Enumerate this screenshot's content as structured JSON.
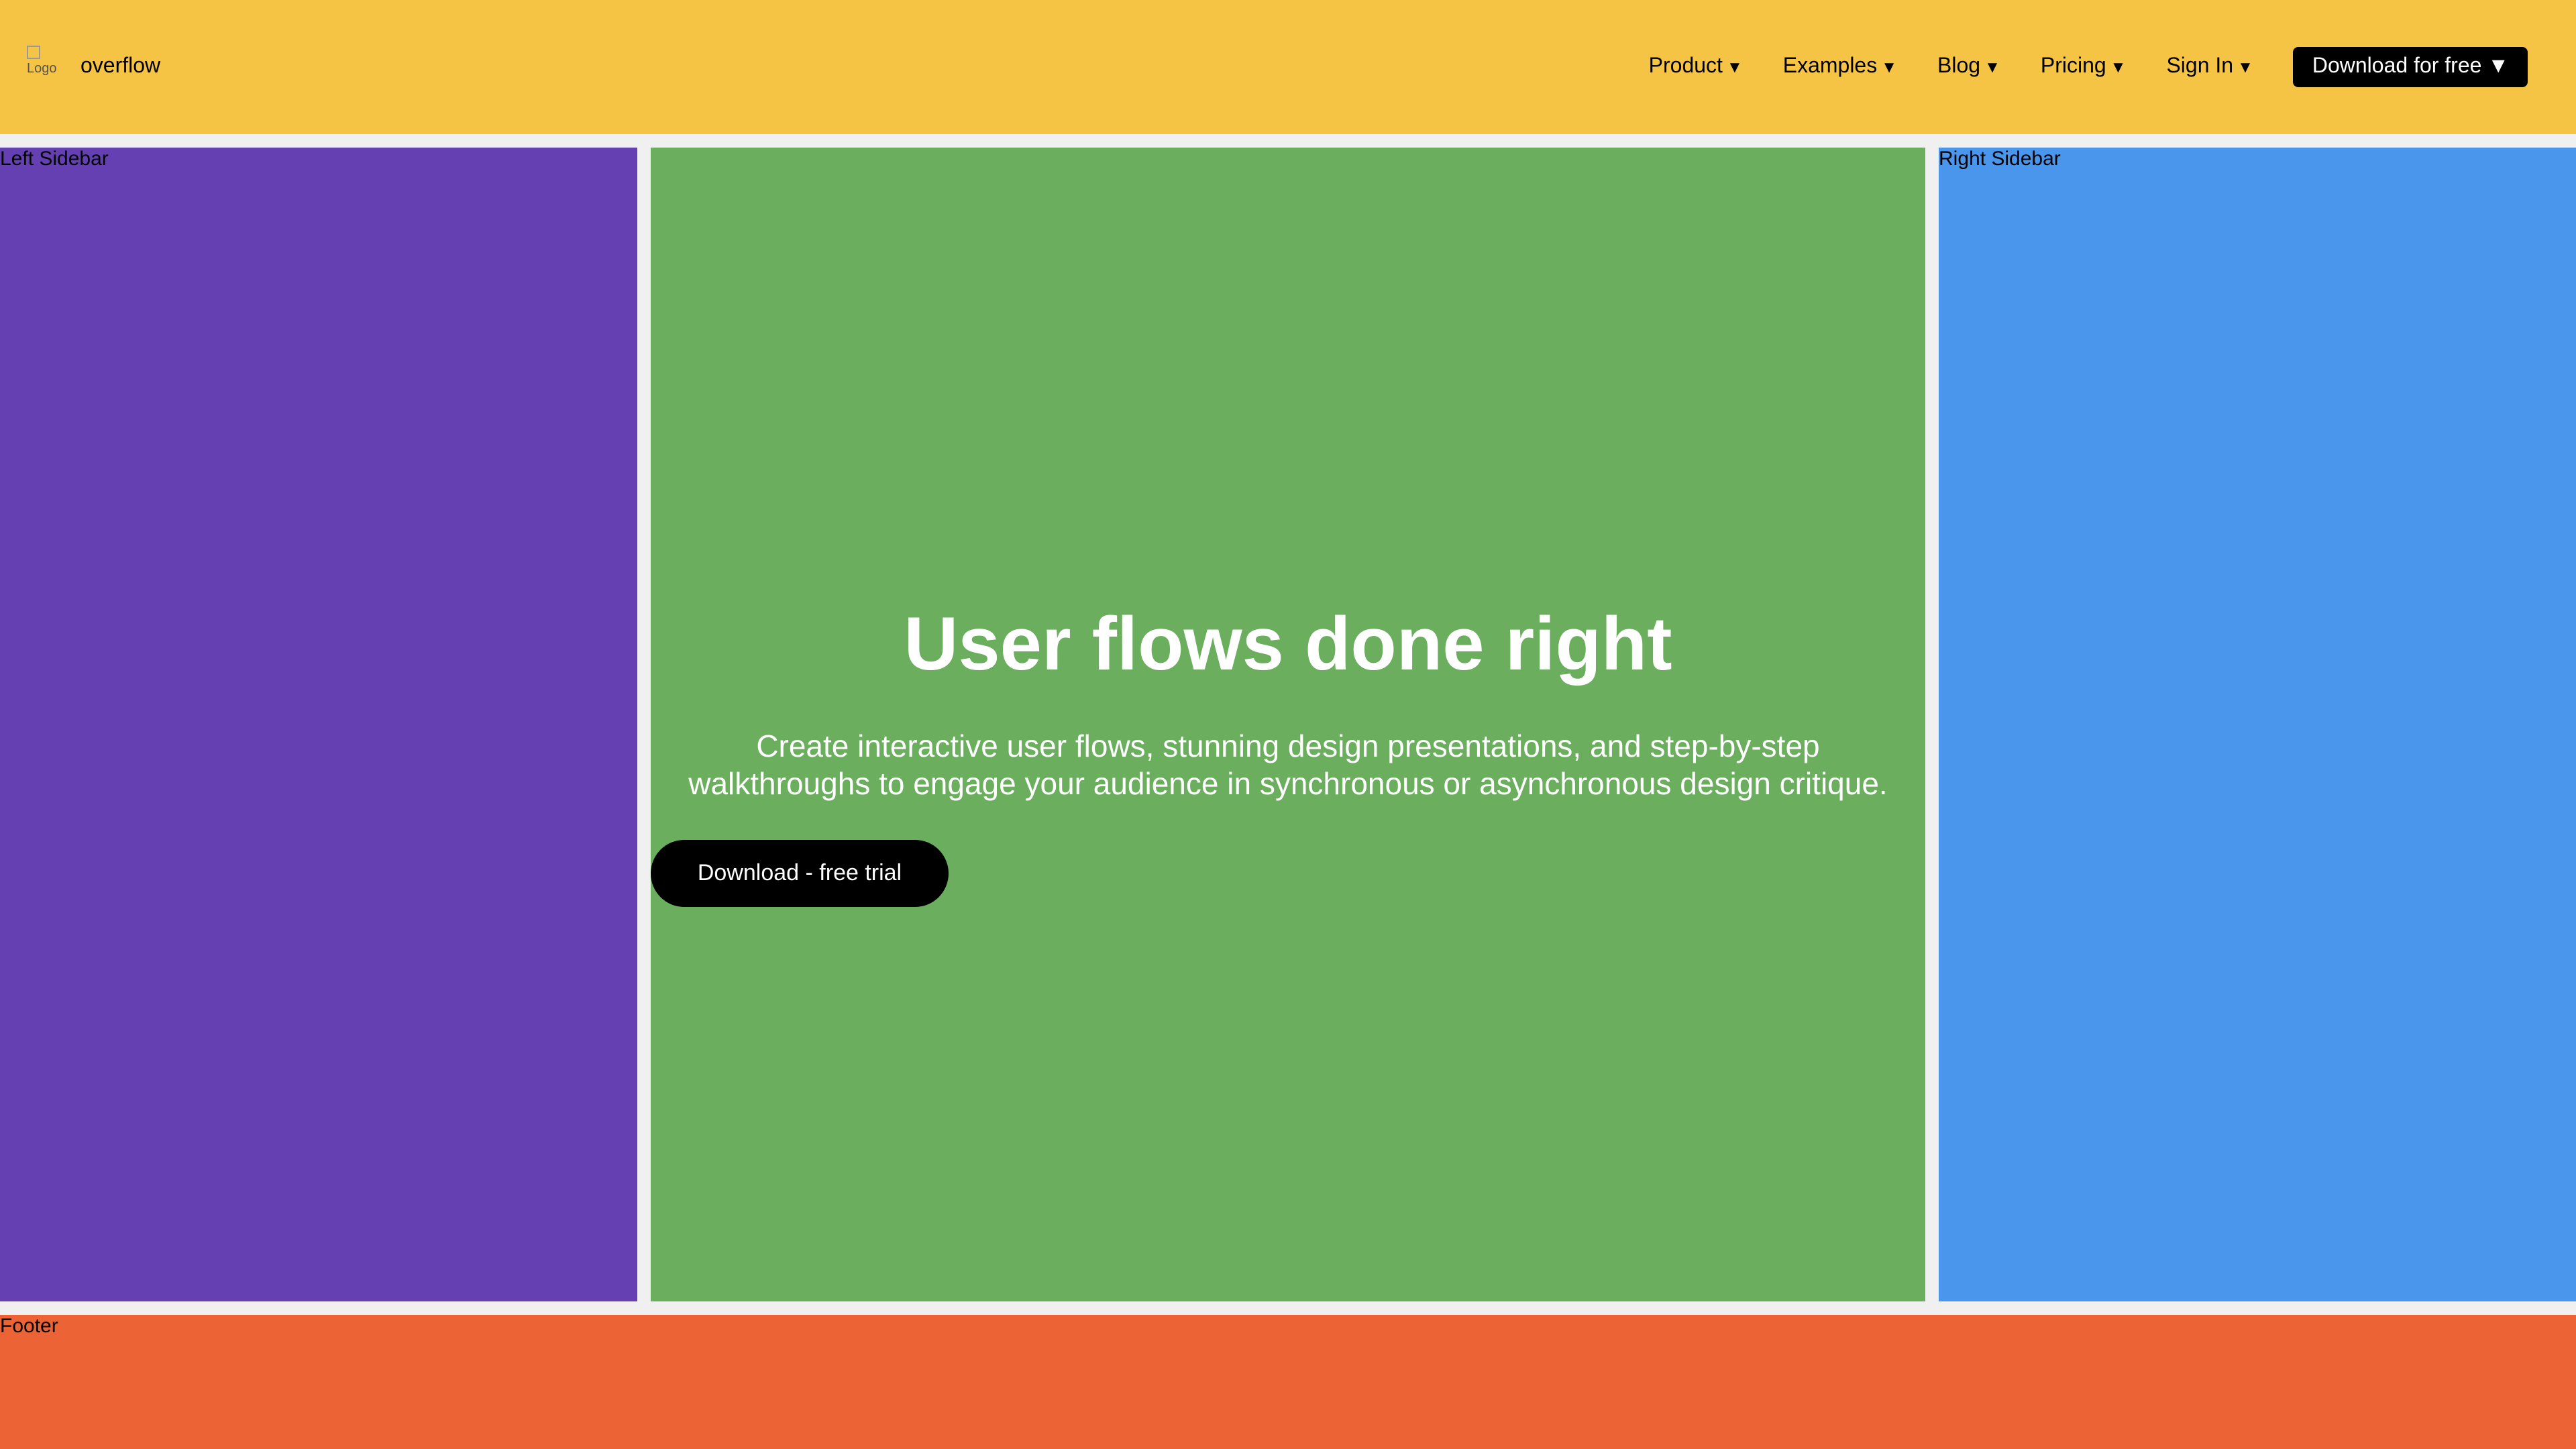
{
  "header": {
    "logo_alt": "Logo",
    "brand": "overflow",
    "nav": [
      {
        "label": "Product",
        "caret": "▼"
      },
      {
        "label": "Examples",
        "caret": "▼"
      },
      {
        "label": "Blog",
        "caret": "▼"
      },
      {
        "label": "Pricing",
        "caret": "▼"
      },
      {
        "label": "Sign In",
        "caret": "▼"
      }
    ],
    "download_label": "Download for free ▼"
  },
  "left_sidebar": {
    "label": "Left Sidebar"
  },
  "main": {
    "title": "User flows done right",
    "subtitle_line1": "Create interactive user flows, stunning design presentations, and step-by-step",
    "subtitle_line2": "walkthroughs to engage your audience in synchronous or asynchronous design critique.",
    "cta_label": "Download - free trial"
  },
  "right_sidebar": {
    "label": "Right Sidebar"
  },
  "footer": {
    "label": "Footer"
  },
  "colors": {
    "header": "#f5c445",
    "left_sidebar": "#6440b2",
    "main": "#6aae5e",
    "right_sidebar": "#4a96ec",
    "footer": "#ec6436",
    "page_background": "#f0f0f0"
  }
}
